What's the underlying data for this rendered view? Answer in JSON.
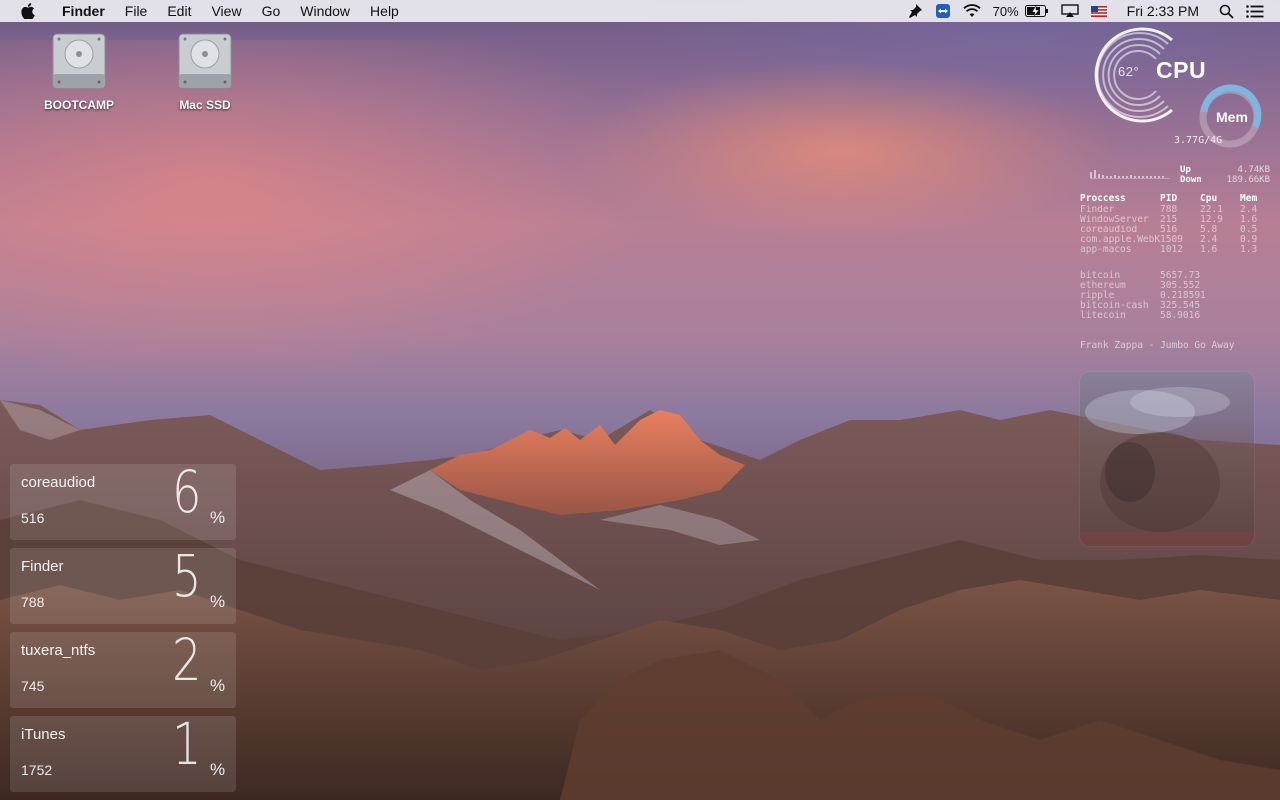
{
  "menubar": {
    "items": [
      "Finder",
      "File",
      "Edit",
      "View",
      "Go",
      "Window",
      "Help"
    ],
    "battery": "70%",
    "clock": "Fri 2:33 PM"
  },
  "desktop": {
    "icons": [
      {
        "label": "BOOTCAMP",
        "icon": "hard-drive-icon"
      },
      {
        "label": "Mac SSD",
        "icon": "hard-drive-icon"
      }
    ]
  },
  "cpu_widget": {
    "temp": "62°",
    "cpu_label": "CPU",
    "mem_label": "Mem",
    "mem_value": "3.77G/4G"
  },
  "network": {
    "up_label": "Up",
    "up_value": "4.74KB",
    "down_label": "Down",
    "down_value": "189.66KB"
  },
  "process_table": {
    "headers": [
      "Proccess",
      "PID",
      "Cpu",
      "Mem"
    ],
    "rows": [
      [
        "Finder",
        "788",
        "22.1",
        "2.4"
      ],
      [
        "WindowServer",
        "215",
        "12.9",
        "1.6"
      ],
      [
        "coreaudiod",
        "516",
        "5.8",
        "0.5"
      ],
      [
        "com.apple.WebKit",
        "1509",
        "2.4",
        "0.9"
      ],
      [
        "app-macos",
        "1012",
        "1.6",
        "1.3"
      ]
    ]
  },
  "crypto": [
    {
      "name": "bitcoin",
      "value": "5657.73"
    },
    {
      "name": "ethereum",
      "value": "305.552"
    },
    {
      "name": "ripple",
      "value": "0.218591"
    },
    {
      "name": "bitcoin-cash",
      "value": "325.545"
    },
    {
      "name": "litecoin",
      "value": "58.9016"
    }
  ],
  "now_playing": "Frank Zappa - Jumbo Go Away",
  "top_processes": [
    {
      "name": "coreaudiod",
      "pid": "516",
      "pct": "6",
      "sign": "%"
    },
    {
      "name": "Finder",
      "pid": "788",
      "pct": "5",
      "sign": "%"
    },
    {
      "name": "tuxera_ntfs",
      "pid": "745",
      "pct": "2",
      "sign": "%"
    },
    {
      "name": "iTunes",
      "pid": "1752",
      "pct": "1",
      "sign": "%"
    }
  ]
}
